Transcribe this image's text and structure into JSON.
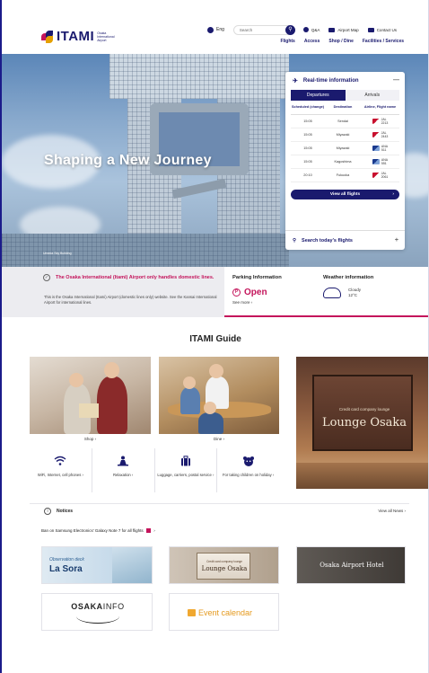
{
  "header": {
    "logo_text": "ITAMI",
    "logo_sub": "Osaka International Airport",
    "lang": "Eng",
    "search_placeholder": "Search",
    "top_links": [
      "Q&A",
      "Airport Map",
      "Contact Us"
    ],
    "nav": [
      "Flights",
      "Access",
      "Shop / Dine",
      "Facilities / Services"
    ]
  },
  "hero": {
    "title": "Shaping a New Journey",
    "caption": "Umeda Sky Building"
  },
  "realtime": {
    "title": "Real-time information",
    "tabs": [
      "Departures",
      "Arrivals"
    ],
    "columns": [
      "Scheduled (change)",
      "Destination",
      "Airline, Flight name"
    ],
    "rows": [
      {
        "time": "15:05",
        "dest": "Sendai",
        "airline": "JAL",
        "flight": "2213",
        "brand": "jal"
      },
      {
        "time": "15:05",
        "dest": "Miyazaki",
        "airline": "JAL",
        "flight": "2443",
        "brand": "jal"
      },
      {
        "time": "15:05",
        "dest": "Miyazaki",
        "airline": "ANA",
        "flight": "511",
        "brand": "ana"
      },
      {
        "time": "15:05",
        "dest": "Kagoshima",
        "airline": "ANA",
        "flight": "551",
        "brand": "ana"
      },
      {
        "time": "20:10",
        "dest": "Fukuoka",
        "airline": "JAL",
        "flight": "2061",
        "brand": "jal"
      }
    ],
    "view_all": "View all flights",
    "search_today": "Search today's flights"
  },
  "info": {
    "notice_title": "The Osaka International (Itami) Airport only handles domestic lines.",
    "notice_body": "This is the Osaka International (Itami) Airport (domestic lines only) website. See the Kansai International Airport for international lines.",
    "parking_title": "Parking Information",
    "parking_status": "Open",
    "parking_more": "See more",
    "weather_title": "Weather information",
    "weather_cond": "Cloudy",
    "weather_temp": "12°C"
  },
  "guide": {
    "title": "ITAMI Guide",
    "shop": "Shop",
    "dine": "Dine",
    "lounge_small": "Credit card company lounge",
    "lounge_big": "Lounge Osaka",
    "services": [
      "WiFi, Internet, cell phones",
      "Relaxation",
      "Luggage, carriers, postal service",
      "For taking children on holiday"
    ]
  },
  "notices": {
    "label": "Notices",
    "view_all": "View all News",
    "item": "Ban on Samsung Electronics' Galaxy Note 7 for all flights"
  },
  "banners": {
    "sora_small": "Observation deck",
    "sora_big": "La Sora",
    "lounge_small": "Credit card company lounge",
    "lounge_big": "Lounge Osaka",
    "hotel": "Osaka Airport Hotel",
    "osakainfo_a": "OSAKA",
    "osakainfo_b": "INFO",
    "event": "Event calendar"
  },
  "colors": {
    "navy": "#1a1a6e",
    "accent": "#c4145b"
  }
}
